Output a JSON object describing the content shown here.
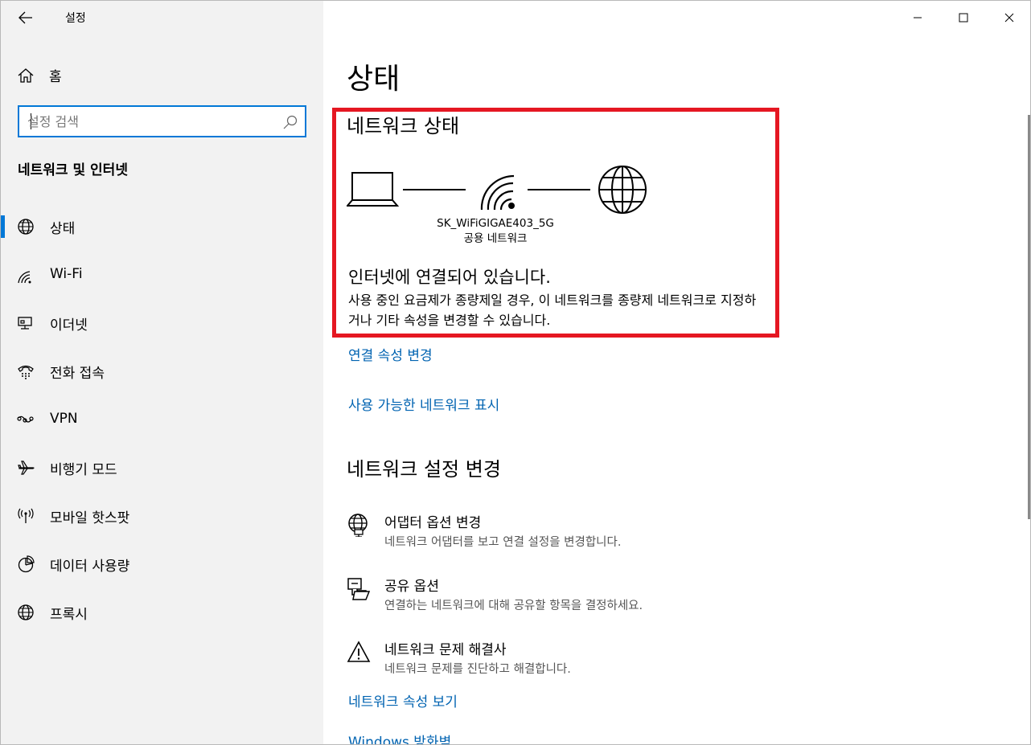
{
  "window": {
    "app_title": "설정",
    "controls": [
      "minimize",
      "maximize",
      "close"
    ]
  },
  "sidebar": {
    "home_label": "홈",
    "search_placeholder": "설정 검색",
    "section_title": "네트워크 및 인터넷",
    "items": [
      {
        "label": "상태",
        "icon": "globe-icon",
        "active": true
      },
      {
        "label": "Wi-Fi",
        "icon": "wifi-icon",
        "active": false
      },
      {
        "label": "이더넷",
        "icon": "ethernet-icon",
        "active": false
      },
      {
        "label": "전화 접속",
        "icon": "dialup-icon",
        "active": false
      },
      {
        "label": "VPN",
        "icon": "vpn-icon",
        "active": false
      },
      {
        "label": "비행기 모드",
        "icon": "airplane-icon",
        "active": false
      },
      {
        "label": "모바일 핫스팟",
        "icon": "hotspot-icon",
        "active": false
      },
      {
        "label": "데이터 사용량",
        "icon": "data-usage-icon",
        "active": false
      },
      {
        "label": "프록시",
        "icon": "proxy-globe-icon",
        "active": false
      }
    ]
  },
  "main": {
    "page_title": "상태",
    "network_status": {
      "title": "네트워크 상태",
      "ssid": "SK_WiFiGIGAE403_5G",
      "network_type": "공용 네트워크",
      "connected_text": "인터넷에 연결되어 있습니다.",
      "description": "사용 중인 요금제가 종량제일 경우, 이 네트워크를 종량제 네트워크로 지정하거나 기타 속성을 변경할 수 있습니다."
    },
    "links": {
      "connection_properties": "연결 속성 변경",
      "show_available_networks": "사용 가능한 네트워크 표시",
      "view_network_properties": "네트워크 속성 보기",
      "windows_firewall": "Windows 방화벽"
    },
    "change_settings": {
      "title": "네트워크 설정 변경",
      "options": [
        {
          "title": "어댑터 옵션 변경",
          "desc": "네트워크 어댑터를 보고 연결 설정을 변경합니다.",
          "icon": "adapter-icon"
        },
        {
          "title": "공유 옵션",
          "desc": "연결하는 네트워크에 대해 공유할 항목을 결정하세요.",
          "icon": "sharing-icon"
        },
        {
          "title": "네트워크 문제 해결사",
          "desc": "네트워크 문제를 진단하고 해결합니다.",
          "icon": "warning-icon"
        }
      ]
    }
  },
  "colors": {
    "accent": "#0078d7",
    "link": "#0063b1",
    "highlight_border": "#e51722",
    "sidebar_bg": "#f2f2f2"
  }
}
